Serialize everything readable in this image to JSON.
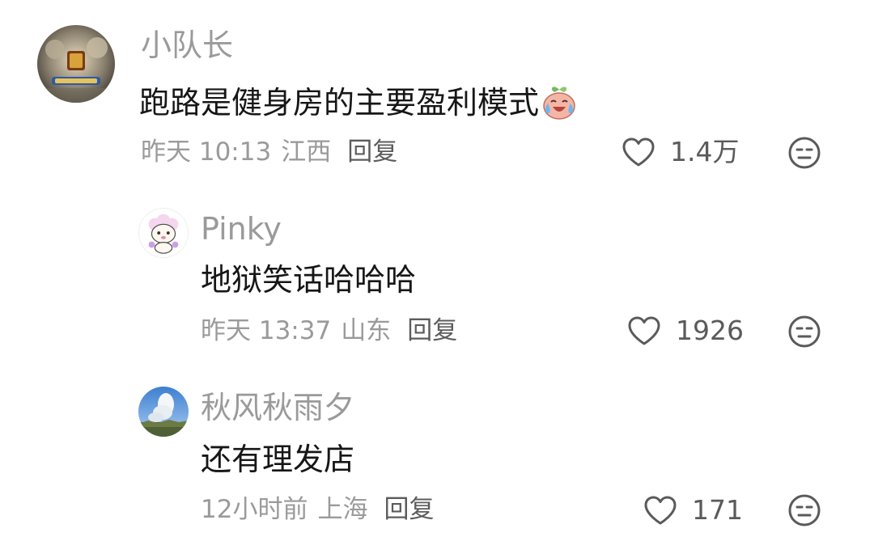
{
  "comments": [
    {
      "username": "小队长",
      "text": "跑路是健身房的主要盈利模式",
      "emoji": "crying-laughing-peach-icon",
      "time": "昨天 10:13",
      "location": "江西",
      "reply_label": "回复",
      "likes": "1.4万"
    },
    {
      "username": "Pinky",
      "text": "地狱笑话哈哈哈",
      "time": "昨天 13:37",
      "location": "山东",
      "reply_label": "回复",
      "likes": "1926"
    },
    {
      "username": "秋风秋雨夕",
      "text": "还有理发店",
      "time": "12小时前",
      "location": "上海",
      "reply_label": "回复",
      "likes": "171"
    }
  ],
  "colors": {
    "meta_gray": "#9a9a9a",
    "text_black": "#161616",
    "icon_gray": "#5a5a5a"
  }
}
